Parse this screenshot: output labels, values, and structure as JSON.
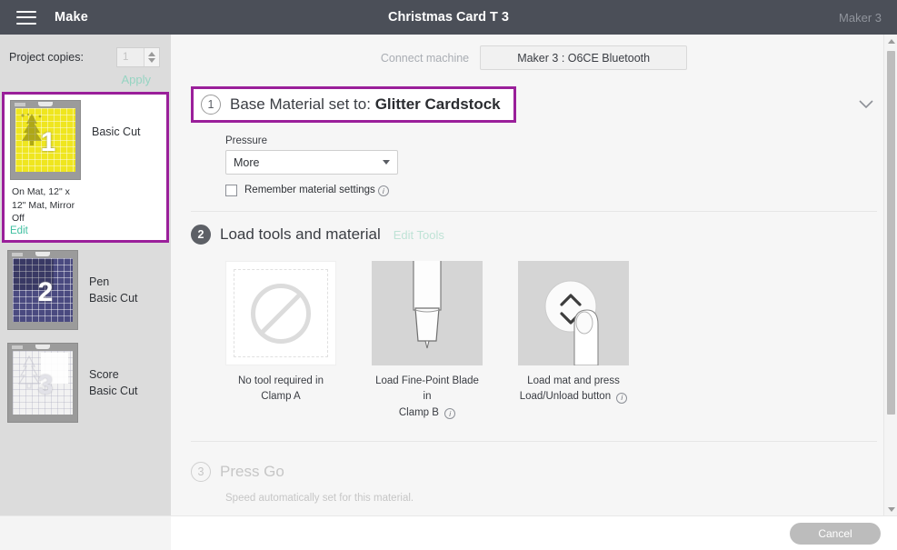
{
  "topbar": {
    "menu_icon": "hamburger-icon",
    "app_label": "Make",
    "project_title": "Christmas Card T 3",
    "machine_label": "Maker 3"
  },
  "sidebar": {
    "copies_label": "Project copies:",
    "copies_value": "1",
    "apply_label": "Apply",
    "mats": [
      {
        "number": "1",
        "title": "Basic Cut",
        "subtitle": "",
        "meta": "On Mat, 12\" x 12\" Mat, Mirror Off",
        "edit_label": "Edit",
        "mat_color": "#efe61f",
        "selected": true
      },
      {
        "number": "2",
        "title": "Pen",
        "subtitle": "Basic Cut",
        "meta": "",
        "edit_label": "",
        "mat_color": "#3b3b72",
        "selected": false
      },
      {
        "number": "3",
        "title": "Score",
        "subtitle": "Basic Cut",
        "meta": "",
        "edit_label": "",
        "mat_color": "#f2f2f2",
        "selected": false
      }
    ]
  },
  "main": {
    "connect_label": "Connect machine",
    "connect_button": "Maker 3 : O6CE Bluetooth",
    "step1": {
      "number": "1",
      "title": "Base Material set to:",
      "value": "Glitter Cardstock",
      "chevron_icon": "chevron-down-icon",
      "pressure_label": "Pressure",
      "pressure_value": "More",
      "remember_label": "Remember material settings",
      "remember_info_icon": "info-icon"
    },
    "step2": {
      "number": "2",
      "title": "Load tools and material",
      "edit_tools_label": "Edit Tools",
      "cards": [
        {
          "icon": "no-tool-icon",
          "line1": "No tool required in",
          "line2": "Clamp A",
          "has_info": false
        },
        {
          "icon": "fine-point-blade-icon",
          "line1": "Load Fine-Point Blade in",
          "line2": "Clamp B",
          "has_info": true
        },
        {
          "icon": "load-unload-button-icon",
          "line1": "Load mat and press",
          "line2": "Load/Unload button",
          "has_info": true
        }
      ]
    },
    "step3": {
      "number": "3",
      "title": "Press Go",
      "note": "Speed automatically set for this material."
    }
  },
  "bottombar": {
    "cancel_label": "Cancel"
  },
  "colors": {
    "accent_purple": "#9a1f9a",
    "teal_link": "#3fbfa0",
    "topbar_bg": "#4b4f58"
  }
}
